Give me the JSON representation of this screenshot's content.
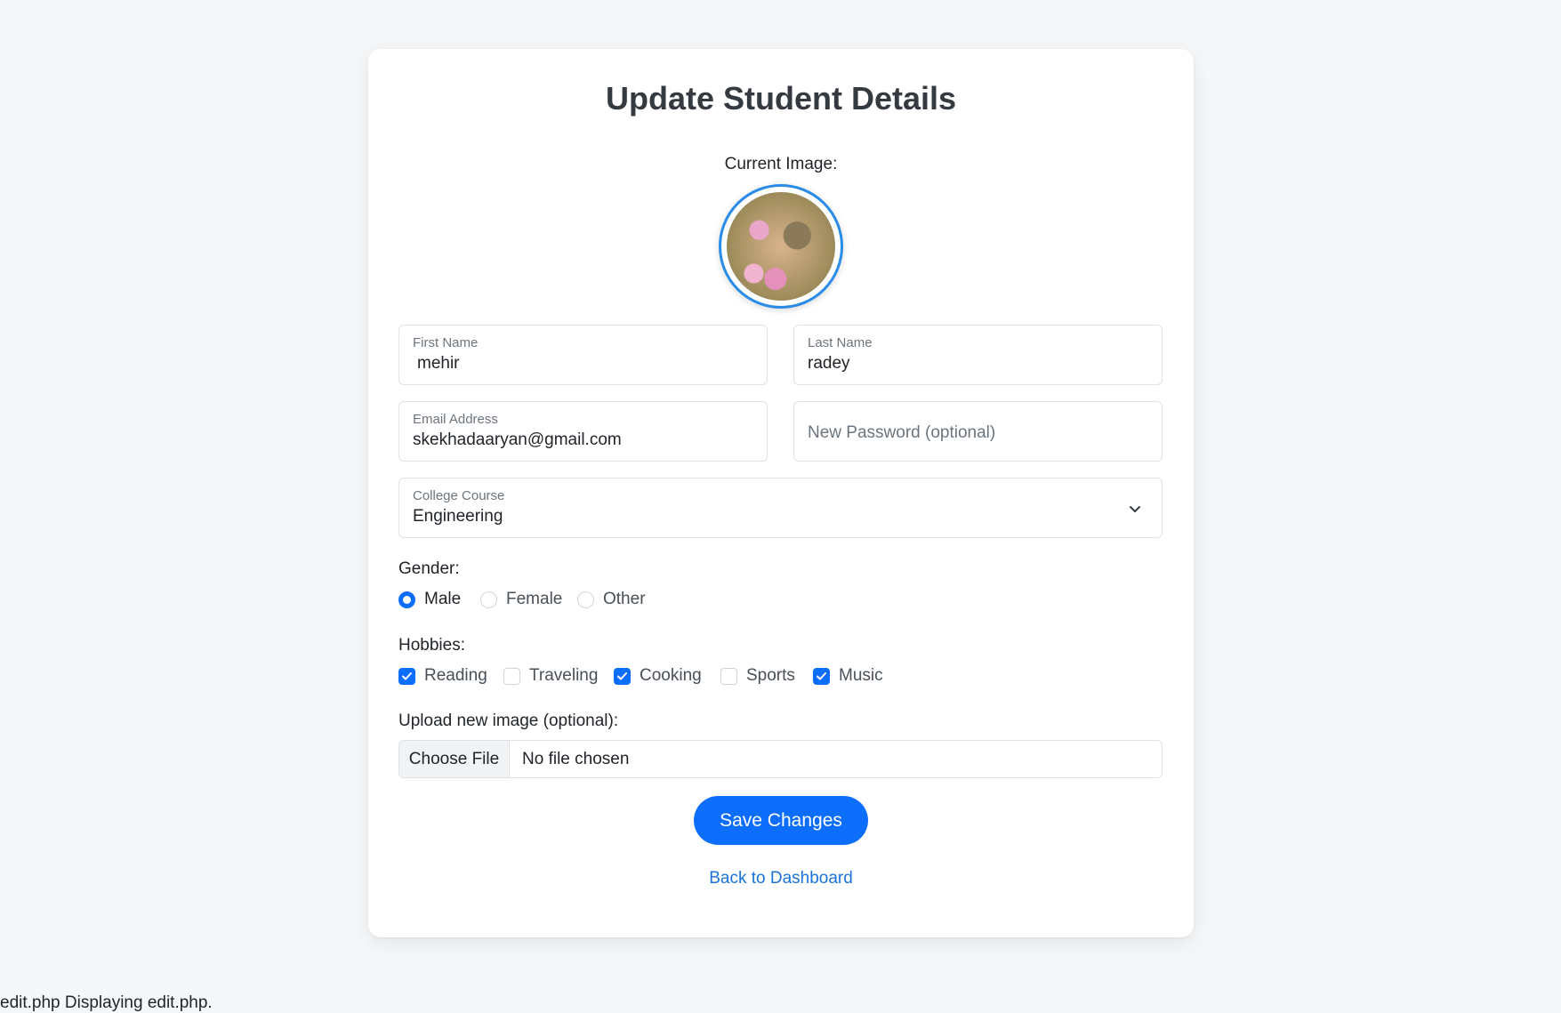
{
  "page": {
    "title": "Update Student Details",
    "current_image_label": "Current Image:"
  },
  "form": {
    "first_name": {
      "label": "First Name",
      "value": "mehir"
    },
    "last_name": {
      "label": "Last Name",
      "value": "radey"
    },
    "email": {
      "label": "Email Address",
      "value": "skekhadaaryan@gmail.com"
    },
    "password": {
      "placeholder": "New Password (optional)"
    },
    "course": {
      "label": "College Course",
      "value": "Engineering"
    },
    "gender": {
      "label": "Gender:",
      "options": [
        {
          "label": "Male",
          "checked": true
        },
        {
          "label": "Female",
          "checked": false
        },
        {
          "label": "Other",
          "checked": false
        }
      ]
    },
    "hobbies": {
      "label": "Hobbies:",
      "options": [
        {
          "label": "Reading",
          "checked": true
        },
        {
          "label": "Traveling",
          "checked": false
        },
        {
          "label": "Cooking",
          "checked": true
        },
        {
          "label": "Sports",
          "checked": false
        },
        {
          "label": "Music",
          "checked": true
        }
      ]
    },
    "upload": {
      "label": "Upload new image (optional):",
      "button_label": "Choose File",
      "status": "No file chosen"
    },
    "save_label": "Save Changes",
    "back_label": "Back to Dashboard"
  },
  "status_bar": "edit.php Displaying edit.php.",
  "colors": {
    "primary": "#0d6efd",
    "link": "#1a73d9",
    "avatar_ring": "#2b8ce8",
    "background": "#f5f7f9"
  },
  "icons": {
    "avatar": "avatar-image",
    "course_select": "chevron-down-icon",
    "checkbox_checked": "checkmark-icon"
  }
}
